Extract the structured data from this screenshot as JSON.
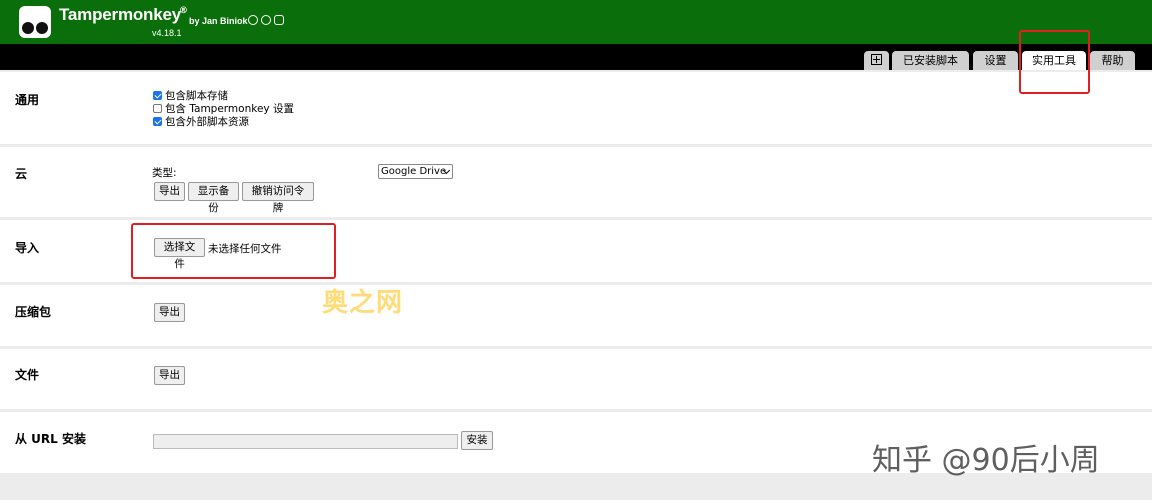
{
  "header": {
    "title": "Tampermonkey",
    "reg_mark": "®",
    "byline": "by Jan Biniok",
    "version": "v4.18.1",
    "bg_color": "#0a6e0a"
  },
  "tabs": [
    {
      "label": "已安装脚本"
    },
    {
      "label": "设置"
    },
    {
      "label": "实用工具",
      "active": true
    },
    {
      "label": "帮助"
    }
  ],
  "sections": {
    "general": {
      "title": "通用",
      "options": [
        {
          "label": "包含脚本存储",
          "checked": true
        },
        {
          "label": "包含 Tampermonkey 设置",
          "checked": false
        },
        {
          "label": "包含外部脚本资源",
          "checked": true
        }
      ]
    },
    "cloud": {
      "title": "云",
      "type_label": "类型:",
      "selected": "Google Drive",
      "buttons": [
        "导出",
        "显示备份",
        "撤销访问令牌"
      ]
    },
    "import": {
      "title": "导入",
      "choose_label": "选择文件",
      "no_file": "未选择任何文件"
    },
    "zip": {
      "title": "压缩包",
      "export_label": "导出"
    },
    "file": {
      "title": "文件",
      "export_label": "导出"
    },
    "url": {
      "title": "从 URL 安装",
      "install_label": "安装"
    }
  },
  "watermarks": {
    "center": "奥之网",
    "corner": "知乎 @90后小周"
  },
  "icons": [
    "github-icon",
    "facebook-icon",
    "instagram-icon",
    "add-script-icon"
  ],
  "accent_red": "#e02020"
}
